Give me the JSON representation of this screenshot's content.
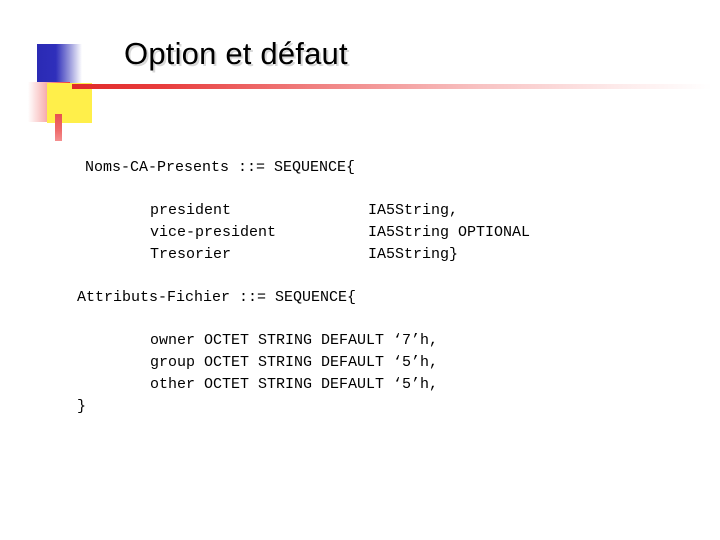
{
  "slide": {
    "title": "Option et défaut",
    "background_color": "#ffffff"
  },
  "decoration": {
    "blue_block_color": "#2a2ab4",
    "pink_block_color": "#ee3b3b",
    "yellow_block_color": "#ffef4a",
    "rule_color": "#e02a2a",
    "stem_color": "#e85050"
  },
  "code": {
    "block1": {
      "header": "Noms-CA-Presents ::= SEQUENCE{",
      "fields": [
        {
          "name": "president",
          "type": "IA5String,"
        },
        {
          "name": "vice-president",
          "type": "IA5String OPTIONAL"
        },
        {
          "name": "Tresorier",
          "type": "IA5String}"
        }
      ]
    },
    "block2": {
      "header": "Attributs-Fichier ::= SEQUENCE{",
      "fields": [
        {
          "line": "owner OCTET STRING DEFAULT ‘7’h,"
        },
        {
          "line": "group OCTET STRING DEFAULT ‘5’h,"
        },
        {
          "line": "other OCTET STRING DEFAULT ‘5’h,"
        }
      ],
      "closing_brace": "}"
    }
  }
}
